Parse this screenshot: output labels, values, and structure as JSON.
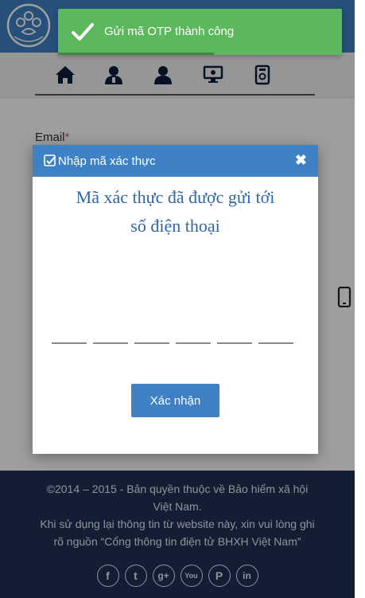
{
  "toast": {
    "message": "Gửi mã OTP thành công",
    "progress": 0.55
  },
  "form": {
    "email_label": "Email",
    "required_mark": "*"
  },
  "nav": {
    "items": [
      {
        "icon": "home-icon"
      },
      {
        "icon": "user-icon"
      },
      {
        "icon": "user-icon"
      },
      {
        "icon": "monitor-icon"
      },
      {
        "icon": "document-icon"
      }
    ]
  },
  "modal": {
    "title": "Nhập mã xác thực",
    "close_symbol": "✖",
    "message_line1": "Mã xác thực đã được gửi tới",
    "message_line2": "số điện thoại",
    "otp_digits": 6,
    "confirm_label": "Xác nhận"
  },
  "footer": {
    "copyright_line1": "©2014 – 2015 - Bản quyền thuộc về Bảo hiểm xã hội",
    "copyright_line2": "Việt Nam.",
    "notice_line1": "Khi sử dụng lại thông tin từ website này, xin vui lòng ghi",
    "notice_line2": "rõ nguồn “Cổng thông tin điện tử BHXH Việt Nam”",
    "social": [
      {
        "icon": "facebook-icon",
        "glyph": "f"
      },
      {
        "icon": "twitter-icon",
        "glyph": "t"
      },
      {
        "icon": "google-plus-icon",
        "glyph": "g+"
      },
      {
        "icon": "youtube-icon",
        "glyph": "You"
      },
      {
        "icon": "pinterest-icon",
        "glyph": "P"
      },
      {
        "icon": "linkedin-icon",
        "glyph": "in"
      }
    ]
  },
  "colors": {
    "brand_blue": "#3e81c4",
    "footer_navy": "#1f3155",
    "toast_green": "#5cb85c",
    "message_blue": "#2e67a6"
  }
}
